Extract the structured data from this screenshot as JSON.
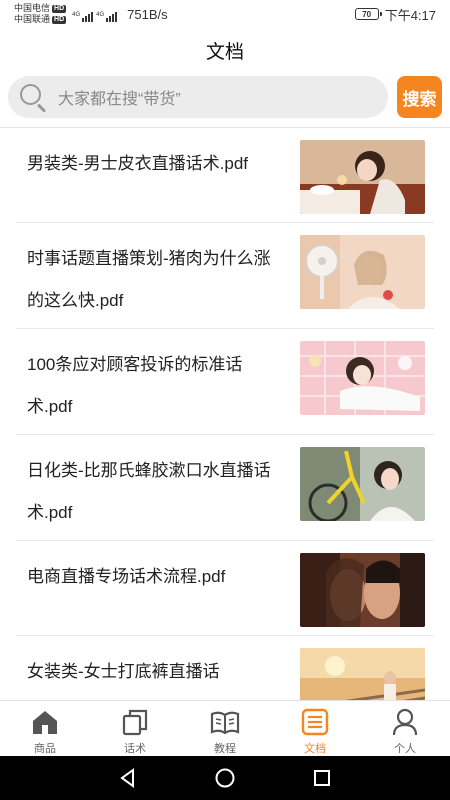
{
  "status_bar": {
    "carrier1": "中国电信",
    "carrier2": "中国联通",
    "hd_badge": "HD",
    "network1": "4G",
    "network2": "4G",
    "speed": "751B/s",
    "battery": "70",
    "time": "下午4:17"
  },
  "header": {
    "title": "文档"
  },
  "search": {
    "placeholder": "大家都在搜“带货”",
    "button_label": "搜索",
    "icon": "search-icon"
  },
  "documents": [
    {
      "title": "男装类-男士皮衣直播话术.pdf",
      "thumbnail": "woman-eating-breakfast-photo"
    },
    {
      "title": "时事话题直播策划-猪肉为什么涨的这么快.pdf",
      "thumbnail": "woman-with-fan-photo"
    },
    {
      "title": "100条应对顾客投诉的标准话术.pdf",
      "thumbnail": "girl-on-pink-bed-photo"
    },
    {
      "title": "日化类-比那氏蜂胶漱口水直播话术.pdf",
      "thumbnail": "woman-with-yellow-bicycle-photo"
    },
    {
      "title": "电商直播专场话术流程.pdf",
      "thumbnail": "couple-close-up-photo"
    },
    {
      "title": "女装类-女士打底裤直播话",
      "thumbnail": "sunset-railway-photo"
    }
  ],
  "tabbar": {
    "active_color": "#f5861f",
    "tabs": [
      {
        "label": "商品",
        "icon": "home-icon"
      },
      {
        "label": "话术",
        "icon": "copy-icon"
      },
      {
        "label": "教程",
        "icon": "book-icon"
      },
      {
        "label": "文档",
        "icon": "document-icon",
        "active": true
      },
      {
        "label": "个人",
        "icon": "person-icon"
      }
    ]
  },
  "system_nav": {
    "back": "back-icon",
    "home": "home-circle-icon",
    "recents": "recents-icon"
  }
}
